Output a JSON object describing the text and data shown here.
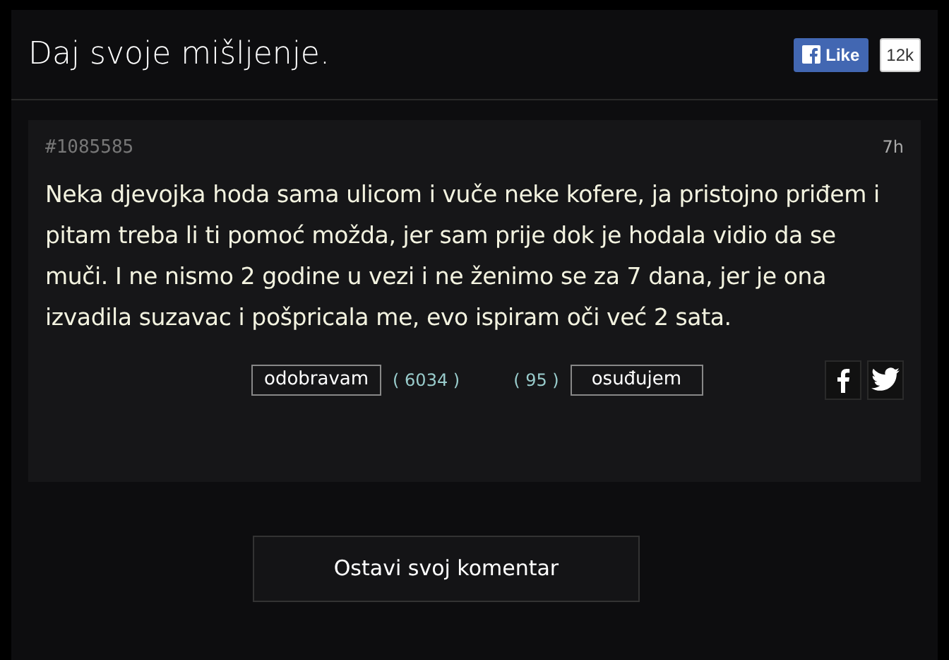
{
  "header": {
    "title": "Daj svoje mišljenje.",
    "like_button": "Like",
    "like_count": "12k"
  },
  "post": {
    "id": "#1085585",
    "time": "7h",
    "text": "Neka djevojka hoda sama ulicom i vuče neke kofere, ja pristojno priđem i pitam treba li ti pomoć možda, jer sam prije dok je hodala vidio da se muči. I ne nismo 2 godine u vezi i ne ženimo se za 7 dana, jer je ona izvadila suzavac i pošpricala me, evo ispiram oči već 2 sata.",
    "approve_button": "odobravam",
    "approve_count": "( 6034 )",
    "condemn_count": "( 95 )",
    "condemn_button": "osuđujem"
  },
  "comment_button": "Ostavi svoj komentar"
}
